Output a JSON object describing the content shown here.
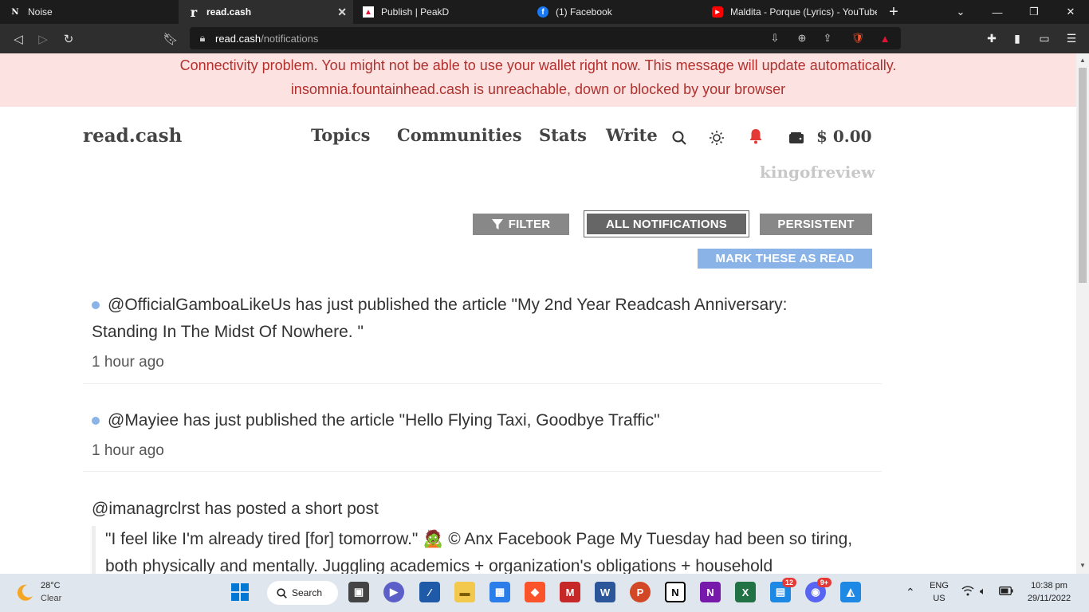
{
  "tabs": [
    {
      "title": "Noise",
      "favicon": "N",
      "active": false
    },
    {
      "title": "read.cash",
      "favicon": "r",
      "active": true
    },
    {
      "title": "Publish | PeakD",
      "favicon": "P",
      "active": false
    },
    {
      "title": "(1) Facebook",
      "favicon": "f",
      "active": false
    },
    {
      "title": "Maldita - Porque (Lyrics) - YouTube",
      "favicon": "▶",
      "active": false
    }
  ],
  "address_bar": {
    "domain": "read.cash",
    "path": "/notifications"
  },
  "banner": {
    "line1": "Connectivity problem. You might not be able to use your wallet right now. This message will update automatically.",
    "line2": "insomnia.fountainhead.cash is unreachable, down or blocked by your browser"
  },
  "site": {
    "logo": "read.cash",
    "nav": {
      "topics": "Topics",
      "communities": "Communities",
      "stats": "Stats",
      "write": "Write"
    },
    "balance": "$ 0.00",
    "username": "kingofreview"
  },
  "buttons": {
    "filter": "FILTER",
    "all_notifications": "ALL NOTIFICATIONS",
    "persistent": "PERSISTENT",
    "mark_read": "MARK THESE AS READ"
  },
  "notifications": [
    {
      "text": "@OfficialGamboaLikeUs has just published the article \"My 2nd Year Readcash Anniversary: Standing In The Midst Of Nowhere. \"",
      "time": "1 hour ago"
    },
    {
      "text": "@Mayiee has just published the article \"Hello Flying Taxi, Goodbye Traffic\"",
      "time": "1 hour ago"
    },
    {
      "text": "@imanagrclrst has posted a short post",
      "quote": "\"I feel like I'm already tired [for] tomorrow.\" 🧟 © Anx Facebook Page My Tuesday had been so tiring, both physically and mentally. Juggling academics + organization's obligations + household"
    }
  ],
  "taskbar": {
    "weather_temp": "28°C",
    "weather_desc": "Clear",
    "search_label": "Search",
    "badge_teams": "12",
    "badge_discord": "9+",
    "language": "ENG",
    "region": "US",
    "time": "10:38 pm",
    "date": "29/11/2022"
  },
  "colors": {
    "banner_bg": "#fde2e2",
    "banner_text": "#b0312d",
    "accent_blue": "#8ab4e8",
    "button_gray": "#888888"
  }
}
